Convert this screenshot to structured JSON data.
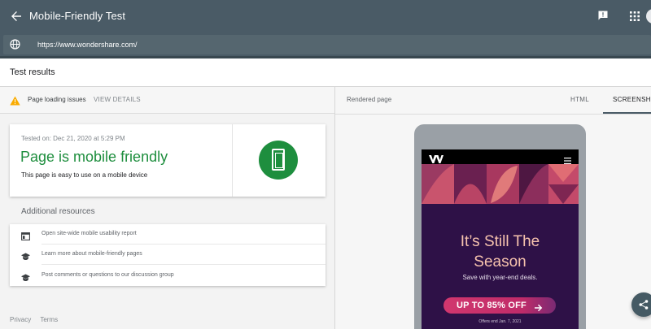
{
  "app": {
    "title": "Mobile-Friendly Test",
    "url": "https://www.wondershare.com/"
  },
  "results": {
    "heading": "Test results",
    "issues_label": "Page loading issues",
    "view_details": "VIEW DETAILS"
  },
  "summary": {
    "tested_on": "Tested on: Dec 21, 2020 at 5:29 PM",
    "headline": "Page is mobile friendly",
    "subtext": "This page is easy to use on a mobile device",
    "status_color": "#1e8e3e"
  },
  "resources": {
    "heading": "Additional resources",
    "items": [
      {
        "icon": "browser-window-icon",
        "label": "Open site-wide mobile usability report"
      },
      {
        "icon": "graduation-cap-icon",
        "label": "Learn more about mobile-friendly pages"
      },
      {
        "icon": "graduation-cap-icon",
        "label": "Post comments or questions to our discussion group"
      }
    ]
  },
  "footer": {
    "privacy": "Privacy",
    "terms": "Terms"
  },
  "rendered": {
    "label": "Rendered page",
    "tabs": [
      {
        "label": "HTML",
        "active": false
      },
      {
        "label": "SCREENSHOT",
        "active": true
      }
    ]
  },
  "preview": {
    "headline_line1": "It’s Still The",
    "headline_line2": "Season",
    "subline": "Save with year-end deals.",
    "cta": "UP TO 85% OFF",
    "fineprint": "Offers end Jan. 7, 2021"
  },
  "colors": {
    "appbar": "#4a5b66",
    "success": "#1e8e3e",
    "preview_bg": "#2e1147",
    "cta": "#d1376e"
  }
}
